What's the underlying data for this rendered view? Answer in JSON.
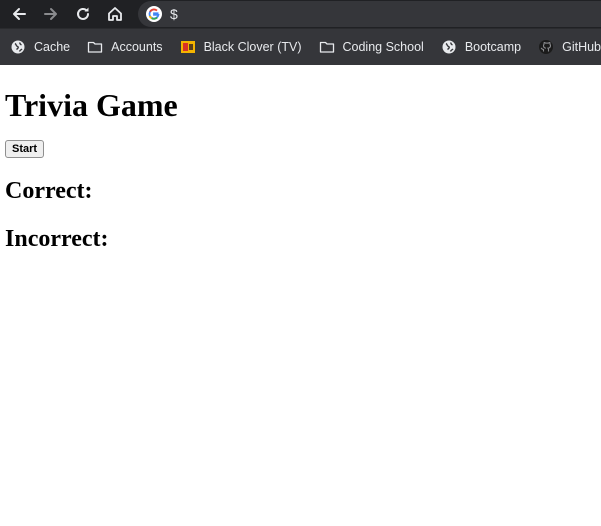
{
  "browser": {
    "omnibox": {
      "url_text": "$"
    },
    "bookmarks": [
      {
        "label": "Cache",
        "icon": "globe-icon"
      },
      {
        "label": "Accounts",
        "icon": "folder-icon"
      },
      {
        "label": "Black Clover (TV)",
        "icon": "anime-site-icon"
      },
      {
        "label": "Coding School",
        "icon": "folder-icon"
      },
      {
        "label": "Bootcamp",
        "icon": "globe-icon"
      },
      {
        "label": "GitHub",
        "icon": "github-icon"
      }
    ]
  },
  "page": {
    "title": "Trivia Game",
    "start_label": "Start",
    "correct_label": "Correct:",
    "incorrect_label": "Incorrect:"
  }
}
